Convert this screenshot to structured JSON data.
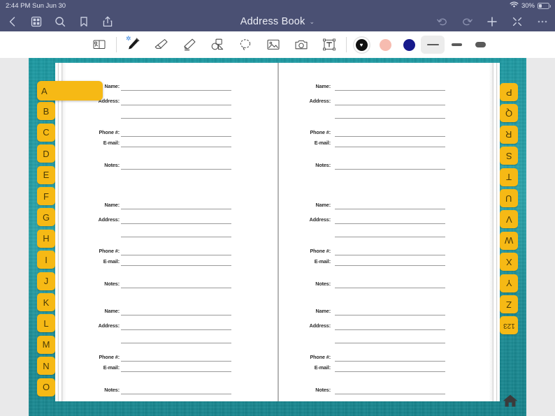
{
  "statusbar": {
    "time": "2:44 PM",
    "date": "Sun Jun 30",
    "wifi_icon": "wifi-icon",
    "battery_percent": "30%",
    "battery_icon": "battery-icon"
  },
  "navbar": {
    "title": "Address Book",
    "title_chevron": "⌄",
    "left_items": [
      {
        "name": "back-button",
        "icon": "chevron-left-icon"
      },
      {
        "name": "thumbnails-button",
        "icon": "grid-icon"
      },
      {
        "name": "search-button",
        "icon": "search-icon"
      },
      {
        "name": "bookmark-button",
        "icon": "bookmark-icon"
      },
      {
        "name": "share-button",
        "icon": "share-icon"
      }
    ],
    "right_items": [
      {
        "name": "undo-button",
        "icon": "undo-icon"
      },
      {
        "name": "redo-button",
        "icon": "redo-icon"
      },
      {
        "name": "add-page-button",
        "icon": "plus-icon"
      },
      {
        "name": "presentation-button",
        "icon": "scissors-icon"
      },
      {
        "name": "more-button",
        "icon": "ellipsis-icon"
      }
    ]
  },
  "toolbar": {
    "tools": [
      {
        "name": "zoom-box-tool",
        "icon": "zoom-window-icon",
        "selected": false,
        "bluetooth": false
      },
      {
        "name": "pen-tool",
        "icon": "pen-icon",
        "selected": true,
        "bluetooth": true
      },
      {
        "name": "eraser-tool",
        "icon": "eraser-icon",
        "selected": false,
        "bluetooth": false
      },
      {
        "name": "highlighter-tool",
        "icon": "highlighter-icon",
        "selected": false,
        "bluetooth": false
      },
      {
        "name": "shape-tool",
        "icon": "shapes-icon",
        "selected": false,
        "bluetooth": false
      },
      {
        "name": "lasso-tool",
        "icon": "lasso-icon",
        "selected": false,
        "bluetooth": false
      },
      {
        "name": "image-tool",
        "icon": "image-icon",
        "selected": false,
        "bluetooth": false
      },
      {
        "name": "camera-tool",
        "icon": "camera-icon",
        "selected": false,
        "bluetooth": false
      },
      {
        "name": "text-tool",
        "icon": "text-box-icon",
        "selected": false,
        "bluetooth": false
      }
    ],
    "colors": [
      {
        "name": "color-swatch-black",
        "hex": "#111111",
        "selected": true
      },
      {
        "name": "color-swatch-pink",
        "hex": "#f7bcb0",
        "selected": false
      },
      {
        "name": "color-swatch-navy",
        "hex": "#171a8c",
        "selected": false
      }
    ],
    "weights": [
      {
        "name": "stroke-weight-thin",
        "thickness": 2,
        "width": 17,
        "selected": true
      },
      {
        "name": "stroke-weight-medium",
        "thickness": 4,
        "width": 15,
        "selected": false
      },
      {
        "name": "stroke-weight-thick",
        "thickness": 8,
        "width": 15,
        "selected": false
      }
    ]
  },
  "notebook": {
    "entry_labels": {
      "name": "Name:",
      "address": "Address:",
      "phone": "Phone #:",
      "email": "E-mail:",
      "notes": "Notes:"
    },
    "left_page": {
      "entries": 3
    },
    "right_page": {
      "entries": 3
    }
  },
  "tabs": {
    "left": [
      "A",
      "B",
      "C",
      "D",
      "E",
      "F",
      "G",
      "H",
      "I",
      "J",
      "K",
      "L",
      "M",
      "N",
      "O"
    ],
    "right": [
      "P",
      "Q",
      "R",
      "S",
      "T",
      "U",
      "V",
      "W",
      "X",
      "Y",
      "Z",
      "123"
    ],
    "selected": "A"
  },
  "home_icon": "home-icon",
  "colors": {
    "nav_bg": "#4a5073",
    "tab_yellow": "#f6b915",
    "canvas_teal": "#1f9ba4",
    "page_white": "#ffffff"
  }
}
